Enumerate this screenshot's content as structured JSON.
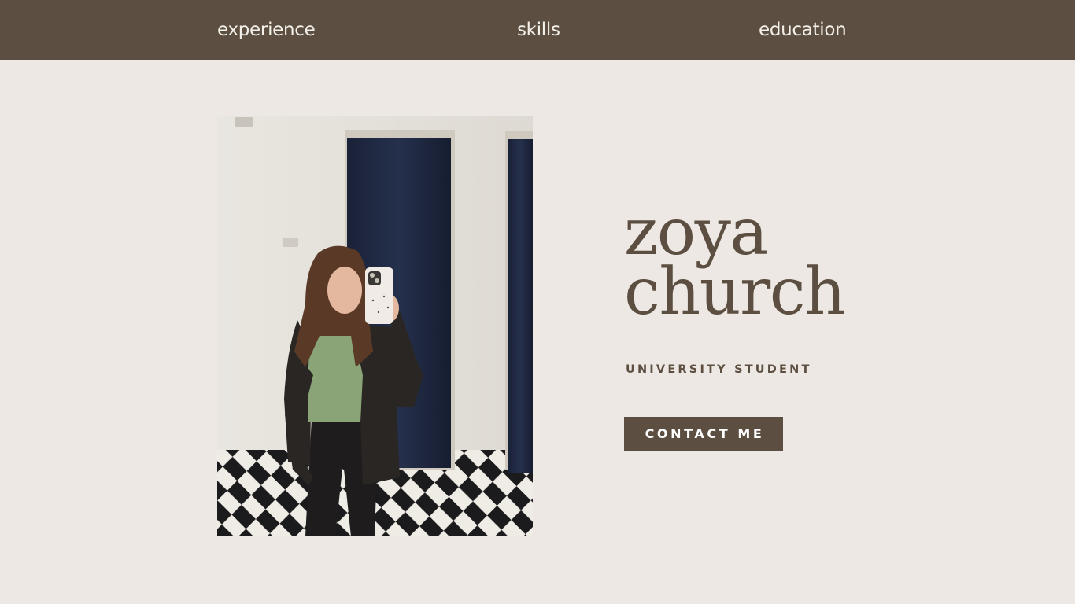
{
  "nav": {
    "items": [
      {
        "label": "experience"
      },
      {
        "label": "skills"
      },
      {
        "label": "education"
      }
    ]
  },
  "hero": {
    "first_name": "zoya",
    "last_name": "church",
    "subtitle": "UNIVERSITY STUDENT",
    "contact_label": "CONTACT ME",
    "photo_icon": "portrait-photo"
  },
  "colors": {
    "nav_background": "#5c4f41",
    "page_background": "#ede8e3",
    "accent": "#5c4f41",
    "nav_text": "#f3efe9"
  }
}
